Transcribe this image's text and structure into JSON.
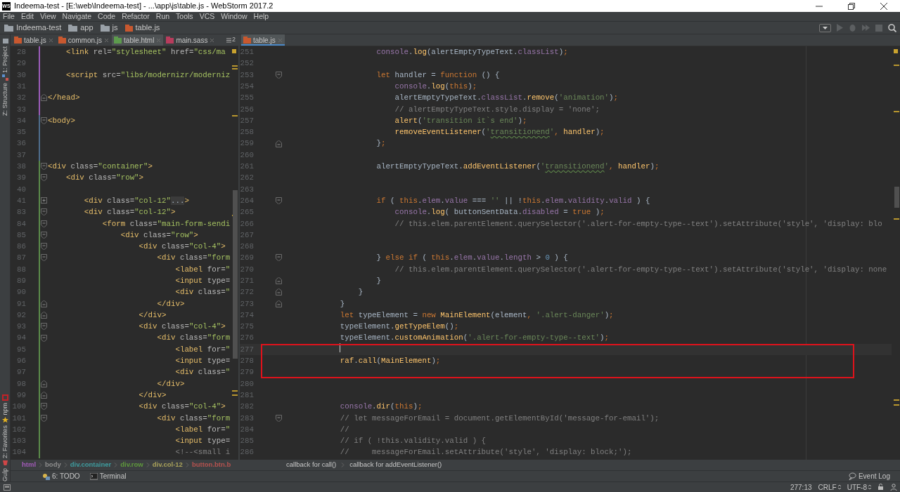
{
  "window": {
    "icon_label": "WS",
    "title": "Indeema-test - [E:\\web\\Indeema-test] - ...\\app\\js\\table.js - WebStorm 2017.2"
  },
  "menu": [
    "File",
    "Edit",
    "View",
    "Navigate",
    "Code",
    "Refactor",
    "Run",
    "Tools",
    "VCS",
    "Window",
    "Help"
  ],
  "navbar": [
    {
      "label": "Indeema-test",
      "kind": "folder"
    },
    {
      "label": "app",
      "kind": "folder"
    },
    {
      "label": "js",
      "kind": "folder"
    },
    {
      "label": "table.js",
      "kind": "js"
    }
  ],
  "side_tools": {
    "top": [
      {
        "label": "1: Project",
        "kind": "project"
      },
      {
        "label": "Z: Structure",
        "kind": "structure"
      }
    ],
    "bottom": [
      {
        "label": "npm",
        "kind": "npm"
      },
      {
        "label": "2: Favorites",
        "kind": "favorites"
      },
      {
        "label": "Gulp",
        "kind": "gulp"
      }
    ]
  },
  "panes": [
    {
      "active": false,
      "overflow": "2",
      "tabs": [
        {
          "label": "table.js",
          "kind": "js",
          "selected": false
        },
        {
          "label": "common.js",
          "kind": "js",
          "selected": false
        },
        {
          "label": "table.html",
          "kind": "html",
          "selected": true
        },
        {
          "label": "main.sass",
          "kind": "sass",
          "selected": false
        }
      ],
      "lines": [
        {
          "number": "28",
          "color": "#9b5cb8",
          "tokens": [
            {
              "kind": "tag",
              "text": "    <link"
            },
            {
              "kind": "attr",
              "text": " rel="
            },
            {
              "kind": "val",
              "text": "\"stylesheet\""
            },
            {
              "kind": "attr",
              "text": " href="
            },
            {
              "kind": "val",
              "text": "\"css/ma"
            }
          ]
        },
        {
          "number": "29",
          "color": "#9b5cb8"
        },
        {
          "number": "30",
          "color": "#9b5cb8",
          "tokens": [
            {
              "kind": "tag",
              "text": "    <script"
            },
            {
              "kind": "attr",
              "text": " src="
            },
            {
              "kind": "val",
              "text": "\"libs/modernizr/moderniz"
            }
          ]
        },
        {
          "number": "31",
          "color": "#9b5cb8"
        },
        {
          "number": "32",
          "color": "#9b5cb8",
          "fold": {
            "kind": "end"
          },
          "tokens": [
            {
              "kind": "tag",
              "text": "</head>"
            }
          ]
        },
        {
          "number": "33",
          "color": "#9b5cb8"
        },
        {
          "number": "34",
          "color": "#4f6d8c",
          "fold": {
            "kind": "start"
          },
          "tokens": [
            {
              "kind": "tag",
              "text": "<body>"
            }
          ]
        },
        {
          "number": "35",
          "color": "#4f6d8c"
        },
        {
          "number": "36",
          "color": "#4f6d8c"
        },
        {
          "number": "37",
          "color": "#4f6d8c"
        },
        {
          "number": "38",
          "color": "#5a8a4a",
          "fold": {
            "kind": "start"
          },
          "tokens": [
            {
              "kind": "tag",
              "text": "<div"
            },
            {
              "kind": "attr",
              "text": " class="
            },
            {
              "kind": "val",
              "text": "\"container\""
            },
            {
              "kind": "tag",
              "text": ">"
            }
          ]
        },
        {
          "number": "39",
          "color": "#5a8a4a",
          "fold": {
            "kind": "start"
          },
          "tokens": [
            {
              "kind": "tag",
              "text": "    <div"
            },
            {
              "kind": "attr",
              "text": " class="
            },
            {
              "kind": "val",
              "text": "\"row\""
            },
            {
              "kind": "tag",
              "text": ">"
            }
          ]
        },
        {
          "number": "40",
          "color": "#5a8a4a"
        },
        {
          "number": "41",
          "color": "#5a8a4a",
          "fold": {
            "kind": "collapsed"
          },
          "tokens": [
            {
              "kind": "tag",
              "text": "        <div"
            },
            {
              "kind": "attr",
              "text": " class="
            },
            {
              "kind": "val",
              "text": "\"col-12\""
            },
            {
              "kind": "folded",
              "text": "..."
            },
            {
              "kind": "tag",
              "text": ">"
            }
          ]
        },
        {
          "number": "83",
          "color": "#5a8a4a",
          "fold": {
            "kind": "start"
          },
          "tokens": [
            {
              "kind": "tag",
              "text": "        <div"
            },
            {
              "kind": "attr",
              "text": " class="
            },
            {
              "kind": "val",
              "text": "\"col-12\""
            },
            {
              "kind": "tag",
              "text": ">"
            }
          ]
        },
        {
          "number": "84",
          "color": "#5a8a4a",
          "fold": {
            "kind": "start"
          },
          "tokens": [
            {
              "kind": "tag",
              "text": "            <form"
            },
            {
              "kind": "attr",
              "text": " class="
            },
            {
              "kind": "val",
              "text": "\"main-form-sendi"
            }
          ]
        },
        {
          "number": "85",
          "color": "#5a8a4a",
          "fold": {
            "kind": "start"
          },
          "tokens": [
            {
              "kind": "tag",
              "text": "                <div"
            },
            {
              "kind": "attr",
              "text": " class="
            },
            {
              "kind": "val",
              "text": "\"row\""
            },
            {
              "kind": "tag",
              "text": ">"
            }
          ]
        },
        {
          "number": "86",
          "color": "#5a8a4a",
          "fold": {
            "kind": "start"
          },
          "tokens": [
            {
              "kind": "tag",
              "text": "                    <div"
            },
            {
              "kind": "attr",
              "text": " class="
            },
            {
              "kind": "val",
              "text": "\"col-4\""
            },
            {
              "kind": "tag",
              "text": ">"
            }
          ]
        },
        {
          "number": "87",
          "color": "#5a8a4a",
          "fold": {
            "kind": "start"
          },
          "tokens": [
            {
              "kind": "tag",
              "text": "                        <div"
            },
            {
              "kind": "attr",
              "text": " class="
            },
            {
              "kind": "val",
              "text": "\"form"
            }
          ]
        },
        {
          "number": "88",
          "color": "#5a8a4a",
          "tokens": [
            {
              "kind": "tag",
              "text": "                            <label"
            },
            {
              "kind": "attr",
              "text": " for="
            },
            {
              "kind": "val",
              "text": "\""
            }
          ]
        },
        {
          "number": "89",
          "color": "#5a8a4a",
          "tokens": [
            {
              "kind": "tag",
              "text": "                            <input"
            },
            {
              "kind": "attr",
              "text": " type="
            }
          ]
        },
        {
          "number": "90",
          "color": "#5a8a4a",
          "tokens": [
            {
              "kind": "tag",
              "text": "                            <div"
            },
            {
              "kind": "attr",
              "text": " class="
            },
            {
              "kind": "val",
              "text": "\""
            }
          ]
        },
        {
          "number": "91",
          "color": "#5a8a4a",
          "fold": {
            "kind": "end"
          },
          "tokens": [
            {
              "kind": "tag",
              "text": "                        </div>"
            }
          ]
        },
        {
          "number": "92",
          "color": "#5a8a4a",
          "fold": {
            "kind": "end"
          },
          "tokens": [
            {
              "kind": "tag",
              "text": "                    </div>"
            }
          ]
        },
        {
          "number": "93",
          "color": "#5a8a4a",
          "fold": {
            "kind": "start"
          },
          "tokens": [
            {
              "kind": "tag",
              "text": "                    <div"
            },
            {
              "kind": "attr",
              "text": " class="
            },
            {
              "kind": "val",
              "text": "\"col-4\""
            },
            {
              "kind": "tag",
              "text": ">"
            }
          ]
        },
        {
          "number": "94",
          "color": "#5a8a4a",
          "fold": {
            "kind": "start"
          },
          "tokens": [
            {
              "kind": "tag",
              "text": "                        <div"
            },
            {
              "kind": "attr",
              "text": " class="
            },
            {
              "kind": "val",
              "text": "\"form"
            }
          ]
        },
        {
          "number": "95",
          "color": "#5a8a4a",
          "tokens": [
            {
              "kind": "tag",
              "text": "                            <label"
            },
            {
              "kind": "attr",
              "text": " for="
            },
            {
              "kind": "val",
              "text": "\""
            }
          ]
        },
        {
          "number": "96",
          "color": "#5a8a4a",
          "tokens": [
            {
              "kind": "tag",
              "text": "                            <input"
            },
            {
              "kind": "attr",
              "text": " type="
            }
          ]
        },
        {
          "number": "97",
          "color": "#5a8a4a",
          "tokens": [
            {
              "kind": "tag",
              "text": "                            <div"
            },
            {
              "kind": "attr",
              "text": " class="
            },
            {
              "kind": "val",
              "text": "\""
            }
          ]
        },
        {
          "number": "98",
          "color": "#5a8a4a",
          "fold": {
            "kind": "end"
          },
          "tokens": [
            {
              "kind": "tag",
              "text": "                        </div>"
            }
          ]
        },
        {
          "number": "99",
          "color": "#5a8a4a",
          "fold": {
            "kind": "end"
          },
          "tokens": [
            {
              "kind": "tag",
              "text": "                    </div>"
            }
          ]
        },
        {
          "number": "100",
          "color": "#5a8a4a",
          "fold": {
            "kind": "start"
          },
          "tokens": [
            {
              "kind": "tag",
              "text": "                    <div"
            },
            {
              "kind": "attr",
              "text": " class="
            },
            {
              "kind": "val",
              "text": "\"col-4\""
            },
            {
              "kind": "tag",
              "text": ">"
            }
          ]
        },
        {
          "number": "101",
          "color": "#5a8a4a",
          "fold": {
            "kind": "start"
          },
          "tokens": [
            {
              "kind": "tag",
              "text": "                        <div"
            },
            {
              "kind": "attr",
              "text": " class="
            },
            {
              "kind": "val",
              "text": "\"form"
            }
          ]
        },
        {
          "number": "102",
          "color": "#5a8a4a",
          "tokens": [
            {
              "kind": "tag",
              "text": "                            <label"
            },
            {
              "kind": "attr",
              "text": " for="
            },
            {
              "kind": "val",
              "text": "\""
            }
          ]
        },
        {
          "number": "103",
          "color": "#5a8a4a",
          "tokens": [
            {
              "kind": "tag",
              "text": "                            <input"
            },
            {
              "kind": "attr",
              "text": " type="
            }
          ]
        },
        {
          "number": "104",
          "color": "#5a8a4a",
          "tokens": [
            {
              "kind": "cmt",
              "text": "                            <!--<small i"
            }
          ]
        }
      ],
      "breadcrumbs": [
        {
          "label": "html",
          "color": "#a25bb8"
        },
        {
          "label": "body",
          "color": "#8d8d8d"
        },
        {
          "label": "div.container",
          "color": "#3e9c9f"
        },
        {
          "label": "div.row",
          "color": "#5f9a3c"
        },
        {
          "label": "div.col-12",
          "color": "#a8a15a"
        },
        {
          "label": "button.btn.b",
          "color": "#b5524f"
        }
      ]
    },
    {
      "active": true,
      "tabs": [
        {
          "label": "table.js",
          "kind": "js",
          "selected": true
        }
      ],
      "lines": [
        {
          "number": "251",
          "tokens": [
            {
              "kind": "prop",
              "text": "                    console"
            },
            {
              "kind": "plain",
              "text": "."
            },
            {
              "kind": "fn",
              "text": "log"
            },
            {
              "kind": "plain",
              "text": "(alertEmptyTypeText."
            },
            {
              "kind": "prop",
              "text": "classList"
            },
            {
              "kind": "plain",
              "text": ")"
            },
            {
              "kind": "kw",
              "text": ";"
            }
          ]
        },
        {
          "number": "252"
        },
        {
          "number": "253",
          "fold": {
            "kind": "start"
          },
          "tokens": [
            {
              "kind": "kw",
              "text": "                    let"
            },
            {
              "kind": "plain",
              "text": " handler = "
            },
            {
              "kind": "kw",
              "text": "function"
            },
            {
              "kind": "plain",
              "text": " () {"
            }
          ]
        },
        {
          "number": "254",
          "tokens": [
            {
              "kind": "prop",
              "text": "                        console"
            },
            {
              "kind": "plain",
              "text": "."
            },
            {
              "kind": "fn",
              "text": "log"
            },
            {
              "kind": "plain",
              "text": "("
            },
            {
              "kind": "kw",
              "text": "this"
            },
            {
              "kind": "plain",
              "text": ")"
            },
            {
              "kind": "kw",
              "text": ";"
            }
          ]
        },
        {
          "number": "255",
          "tokens": [
            {
              "kind": "plain",
              "text": "                        alertEmptyTypeText."
            },
            {
              "kind": "prop",
              "text": "classList"
            },
            {
              "kind": "plain",
              "text": "."
            },
            {
              "kind": "fn",
              "text": "remove"
            },
            {
              "kind": "plain",
              "text": "("
            },
            {
              "kind": "str",
              "text": "'animation'"
            },
            {
              "kind": "plain",
              "text": ")"
            },
            {
              "kind": "kw",
              "text": ";"
            }
          ]
        },
        {
          "number": "256",
          "tokens": [
            {
              "kind": "cmt",
              "text": "                        // alertEmptyTypeText.style.display = 'none';"
            }
          ]
        },
        {
          "number": "257",
          "tokens": [
            {
              "kind": "fn",
              "text": "                        alert"
            },
            {
              "kind": "plain",
              "text": "("
            },
            {
              "kind": "str",
              "text": "'transition it`s end'"
            },
            {
              "kind": "plain",
              "text": ")"
            },
            {
              "kind": "kw",
              "text": ";"
            }
          ]
        },
        {
          "number": "258",
          "tokens": [
            {
              "kind": "fn",
              "text": "                        removeEventListener"
            },
            {
              "kind": "plain",
              "text": "("
            },
            {
              "kind": "str",
              "text": "'"
            },
            {
              "kind": "typo",
              "text": "transitionend"
            },
            {
              "kind": "str",
              "text": "'"
            },
            {
              "kind": "kw",
              "text": ", "
            },
            {
              "kind": "fn",
              "text": "handler"
            },
            {
              "kind": "plain",
              "text": ")"
            },
            {
              "kind": "kw",
              "text": ";"
            }
          ]
        },
        {
          "number": "259",
          "fold": {
            "kind": "end"
          },
          "tokens": [
            {
              "kind": "plain",
              "text": "                    }"
            },
            {
              "kind": "kw",
              "text": ";"
            }
          ]
        },
        {
          "number": "260"
        },
        {
          "number": "261",
          "tokens": [
            {
              "kind": "plain",
              "text": "                    alertEmptyTypeText."
            },
            {
              "kind": "fn",
              "text": "addEventListener"
            },
            {
              "kind": "plain",
              "text": "("
            },
            {
              "kind": "str",
              "text": "'"
            },
            {
              "kind": "typo",
              "text": "transitionend"
            },
            {
              "kind": "str",
              "text": "'"
            },
            {
              "kind": "kw",
              "text": ", "
            },
            {
              "kind": "fn",
              "text": "handler"
            },
            {
              "kind": "plain",
              "text": ")"
            },
            {
              "kind": "kw",
              "text": ";"
            }
          ]
        },
        {
          "number": "262"
        },
        {
          "number": "263"
        },
        {
          "number": "264",
          "fold": {
            "kind": "start"
          },
          "tokens": [
            {
              "kind": "kw",
              "text": "                    if"
            },
            {
              "kind": "plain",
              "text": " ( "
            },
            {
              "kind": "kw",
              "text": "this"
            },
            {
              "kind": "plain",
              "text": "."
            },
            {
              "kind": "prop",
              "text": "elem"
            },
            {
              "kind": "plain",
              "text": "."
            },
            {
              "kind": "prop",
              "text": "value"
            },
            {
              "kind": "plain",
              "text": " === "
            },
            {
              "kind": "str",
              "text": "''"
            },
            {
              "kind": "plain",
              "text": " || !"
            },
            {
              "kind": "kw",
              "text": "this"
            },
            {
              "kind": "plain",
              "text": "."
            },
            {
              "kind": "prop",
              "text": "elem"
            },
            {
              "kind": "plain",
              "text": "."
            },
            {
              "kind": "prop",
              "text": "validity"
            },
            {
              "kind": "plain",
              "text": "."
            },
            {
              "kind": "prop",
              "text": "valid"
            },
            {
              "kind": "plain",
              "text": " ) {"
            }
          ]
        },
        {
          "number": "265",
          "tokens": [
            {
              "kind": "prop",
              "text": "                        console"
            },
            {
              "kind": "plain",
              "text": "."
            },
            {
              "kind": "fn",
              "text": "log"
            },
            {
              "kind": "plain",
              "text": "( buttonSentData."
            },
            {
              "kind": "prop",
              "text": "disabled"
            },
            {
              "kind": "plain",
              "text": " = "
            },
            {
              "kind": "kw",
              "text": "true"
            },
            {
              "kind": "plain",
              "text": " )"
            },
            {
              "kind": "kw",
              "text": ";"
            }
          ]
        },
        {
          "number": "266",
          "tokens": [
            {
              "kind": "cmt",
              "text": "                        // this.elem.parentElement.querySelector('.alert-for-empty-type--text').setAttribute('style', 'display: blo"
            }
          ]
        },
        {
          "number": "267"
        },
        {
          "number": "268"
        },
        {
          "number": "269",
          "fold": {
            "kind": "start"
          },
          "tokens": [
            {
              "kind": "plain",
              "text": "                    } "
            },
            {
              "kind": "kw",
              "text": "else if"
            },
            {
              "kind": "plain",
              "text": " ( "
            },
            {
              "kind": "kw",
              "text": "this"
            },
            {
              "kind": "plain",
              "text": "."
            },
            {
              "kind": "prop",
              "text": "elem"
            },
            {
              "kind": "plain",
              "text": "."
            },
            {
              "kind": "prop",
              "text": "value"
            },
            {
              "kind": "plain",
              "text": "."
            },
            {
              "kind": "prop",
              "text": "length"
            },
            {
              "kind": "plain",
              "text": " > "
            },
            {
              "kind": "num",
              "text": "0"
            },
            {
              "kind": "plain",
              "text": " ) {"
            }
          ]
        },
        {
          "number": "270",
          "tokens": [
            {
              "kind": "cmt",
              "text": "                        // this.elem.parentElement.querySelector('.alert-for-empty-type--text').setAttribute('style', 'display: none"
            }
          ]
        },
        {
          "number": "271",
          "fold": {
            "kind": "end"
          },
          "tokens": [
            {
              "kind": "plain",
              "text": "                    }"
            }
          ]
        },
        {
          "number": "272",
          "fold": {
            "kind": "end"
          },
          "tokens": [
            {
              "kind": "plain",
              "text": "                }"
            }
          ]
        },
        {
          "number": "273",
          "fold": {
            "kind": "end"
          },
          "tokens": [
            {
              "kind": "plain",
              "text": "            }"
            }
          ]
        },
        {
          "number": "274",
          "tokens": [
            {
              "kind": "kw",
              "text": "            let"
            },
            {
              "kind": "plain",
              "text": " typeElement = "
            },
            {
              "kind": "kw",
              "text": "new "
            },
            {
              "kind": "fn",
              "text": "MainElement"
            },
            {
              "kind": "plain",
              "text": "(element"
            },
            {
              "kind": "kw",
              "text": ", "
            },
            {
              "kind": "str",
              "text": "'.alert-danger'"
            },
            {
              "kind": "plain",
              "text": ")"
            },
            {
              "kind": "kw",
              "text": ";"
            }
          ]
        },
        {
          "number": "275",
          "tokens": [
            {
              "kind": "plain",
              "text": "            typeElement."
            },
            {
              "kind": "fn",
              "text": "getTypeElem"
            },
            {
              "kind": "plain",
              "text": "()"
            },
            {
              "kind": "kw",
              "text": ";"
            }
          ]
        },
        {
          "number": "276",
          "tokens": [
            {
              "kind": "plain",
              "text": "            typeElement."
            },
            {
              "kind": "fn",
              "text": "customAnimation"
            },
            {
              "kind": "plain",
              "text": "("
            },
            {
              "kind": "str",
              "text": "'.alert-for-empty-type--text'"
            },
            {
              "kind": "plain",
              "text": ")"
            },
            {
              "kind": "kw",
              "text": ";"
            }
          ]
        },
        {
          "number": "277",
          "current": true,
          "highlighted": true
        },
        {
          "number": "278",
          "current": false,
          "highlighted": true,
          "tokens": [
            {
              "kind": "fn",
              "text": "            raf"
            },
            {
              "kind": "plain",
              "text": "."
            },
            {
              "kind": "fn",
              "text": "call"
            },
            {
              "kind": "plain",
              "text": "("
            },
            {
              "kind": "fn",
              "text": "MainElement"
            },
            {
              "kind": "plain",
              "text": ")"
            },
            {
              "kind": "kw",
              "text": ";"
            }
          ]
        },
        {
          "number": "279",
          "current": false,
          "highlighted": true
        },
        {
          "number": "280"
        },
        {
          "number": "281"
        },
        {
          "number": "282",
          "tokens": [
            {
              "kind": "prop",
              "text": "            console"
            },
            {
              "kind": "plain",
              "text": "."
            },
            {
              "kind": "fn",
              "text": "dir"
            },
            {
              "kind": "plain",
              "text": "("
            },
            {
              "kind": "kw",
              "text": "this"
            },
            {
              "kind": "plain",
              "text": ")"
            },
            {
              "kind": "kw",
              "text": ";"
            }
          ]
        },
        {
          "number": "283",
          "fold": {
            "kind": "start"
          },
          "tokens": [
            {
              "kind": "cmt",
              "text": "            // let messageForEmail = document.getElementById('message-for-email');"
            }
          ]
        },
        {
          "number": "284",
          "tokens": [
            {
              "kind": "cmt",
              "text": "            //"
            }
          ]
        },
        {
          "number": "285",
          "tokens": [
            {
              "kind": "cmt",
              "text": "            // if ( !this.validity.valid ) {"
            }
          ]
        },
        {
          "number": "286",
          "tokens": [
            {
              "kind": "cmt",
              "text": "            //     messageForEmail.setAttribute('style', 'display: block;');"
            }
          ]
        }
      ],
      "breadcrumbs": [
        {
          "label": "callback for call()"
        },
        {
          "label": "callback for addEventListener()"
        }
      ]
    }
  ],
  "tool_windows": [
    {
      "label": "6: TODO",
      "kind": "todo"
    },
    {
      "label": "Terminal",
      "kind": "terminal"
    }
  ],
  "event_log": "Event Log",
  "status": {
    "position": "277:13",
    "line_separator": "CRLF",
    "encoding": "UTF-8"
  }
}
